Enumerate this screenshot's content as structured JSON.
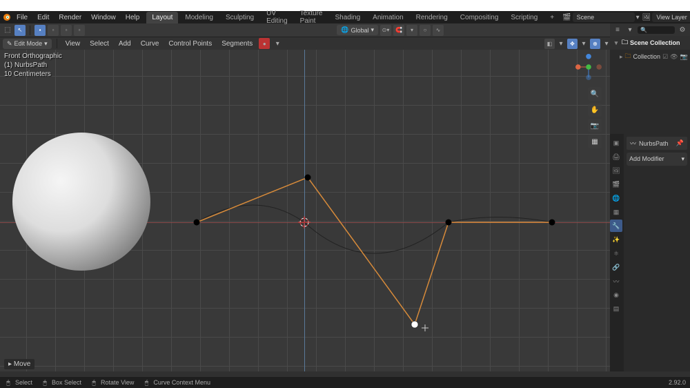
{
  "titlebar": "",
  "topmenu": {
    "file": "File",
    "edit": "Edit",
    "render": "Render",
    "window": "Window",
    "help": "Help"
  },
  "tabs": [
    "Layout",
    "Modeling",
    "Sculpting",
    "UV Editing",
    "Texture Paint",
    "Shading",
    "Animation",
    "Rendering",
    "Compositing",
    "Scripting"
  ],
  "active_tab": "Layout",
  "scene": {
    "label": "Scene",
    "layer": "View Layer"
  },
  "orientation": "Global",
  "mode": "Edit Mode",
  "view_menu": {
    "view": "View",
    "select": "Select",
    "add": "Add",
    "curve": "Curve",
    "control_points": "Control Points",
    "segments": "Segments"
  },
  "viewport": {
    "info1": "Front Orthographic",
    "info2": "(1) NurbsPath",
    "info3": "10 Centimeters",
    "move_hint": "Move"
  },
  "outliner": {
    "scene_collection": "Scene Collection",
    "collection": "Collection"
  },
  "properties": {
    "object": "NurbsPath",
    "add_modifier": "Add Modifier"
  },
  "status": {
    "select": "Select",
    "box": "Box Select",
    "rotate": "Rotate View",
    "context": "Curve Context Menu",
    "version": "2.92.0"
  }
}
